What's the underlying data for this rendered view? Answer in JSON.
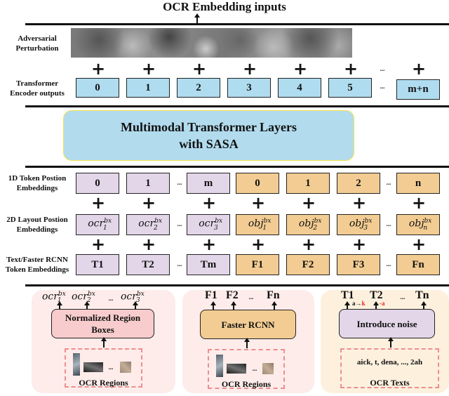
{
  "title": "OCR Embedding inputs",
  "rows": {
    "adversarial": {
      "label_line1": "Adversarial",
      "label_line2": "Perturbation"
    },
    "encoder": {
      "label_line1": "Transformer",
      "label_line2": "Encoder outputs",
      "tokens": [
        "0",
        "1",
        "2",
        "3",
        "4",
        "5",
        "m+n"
      ],
      "ellipsis": "..."
    },
    "multimodal": {
      "line1": "Multimodal Transformer Layers",
      "line2": "with SASA"
    },
    "position_1d": {
      "label_line1": "1D Token Postion",
      "label_line2": "Embeddings",
      "ocr_tokens": [
        "0",
        "1",
        "m"
      ],
      "obj_tokens": [
        "0",
        "1",
        "2",
        "n"
      ],
      "ellipsis": "..."
    },
    "layout_2d": {
      "label_line1": "2D Layout Postion",
      "label_line2": "Embeddings",
      "ocr_tokens": [
        {
          "base": "ocr",
          "sup": "bx",
          "sub": "1"
        },
        {
          "base": "ocr",
          "sup": "bx",
          "sub": "2"
        },
        {
          "base": "ocr",
          "sup": "bx",
          "sub": "3"
        }
      ],
      "obj_tokens": [
        {
          "base": "obj",
          "sup": "bx",
          "sub": "1"
        },
        {
          "base": "obj",
          "sup": "bx",
          "sub": "2"
        },
        {
          "base": "obj",
          "sup": "bx",
          "sub": "3"
        },
        {
          "base": "obj",
          "sup": "bx",
          "sub": "n"
        }
      ],
      "ellipsis": "..."
    },
    "token_emb": {
      "label_line1": "Text/Faster RCNN",
      "label_line2": "Token Embeddings",
      "ocr_tokens": [
        "T1",
        "T2",
        "Tm"
      ],
      "obj_tokens": [
        "F1",
        "F2",
        "F3",
        "Fn"
      ],
      "ellipsis": "..."
    },
    "plus_symbol": "+"
  },
  "panels": {
    "left": {
      "outputs": [
        {
          "base": "ocr",
          "sup": "bx",
          "sub": "1"
        },
        {
          "base": "ocr",
          "sup": "bx",
          "sub": "2"
        },
        {
          "base": "ocr",
          "sup": "bx",
          "sub": "3"
        }
      ],
      "ellipsis": "...",
      "process_line1": "Normalized Region",
      "process_line2": "Boxes",
      "input_label": "OCR Regions",
      "thumb_ellipsis": "..."
    },
    "middle": {
      "outputs": [
        "F1",
        "F2",
        "Fn"
      ],
      "ellipsis": "...",
      "process": "Faster RCNN",
      "input_label": "OCR Regions",
      "thumb_ellipsis": "..."
    },
    "right": {
      "outputs": [
        "T1",
        "T2",
        "Tn"
      ],
      "ellipsis": "...",
      "noise_ops": {
        "a_to": "a→",
        "k": "k",
        "minus_a": "-a"
      },
      "process": "Introduce noise",
      "input_text": "aick, t, dena, ..., 2ah",
      "input_label": "OCR Texts"
    }
  },
  "colors": {
    "encoder_blue": "#b0dcf0",
    "ocr_purple": "#e2d6e8",
    "obj_orange": "#f2cc92",
    "noise_red": "#e8231f",
    "panel_pink": "#fdecea",
    "panel_peach": "#fdf1de"
  }
}
